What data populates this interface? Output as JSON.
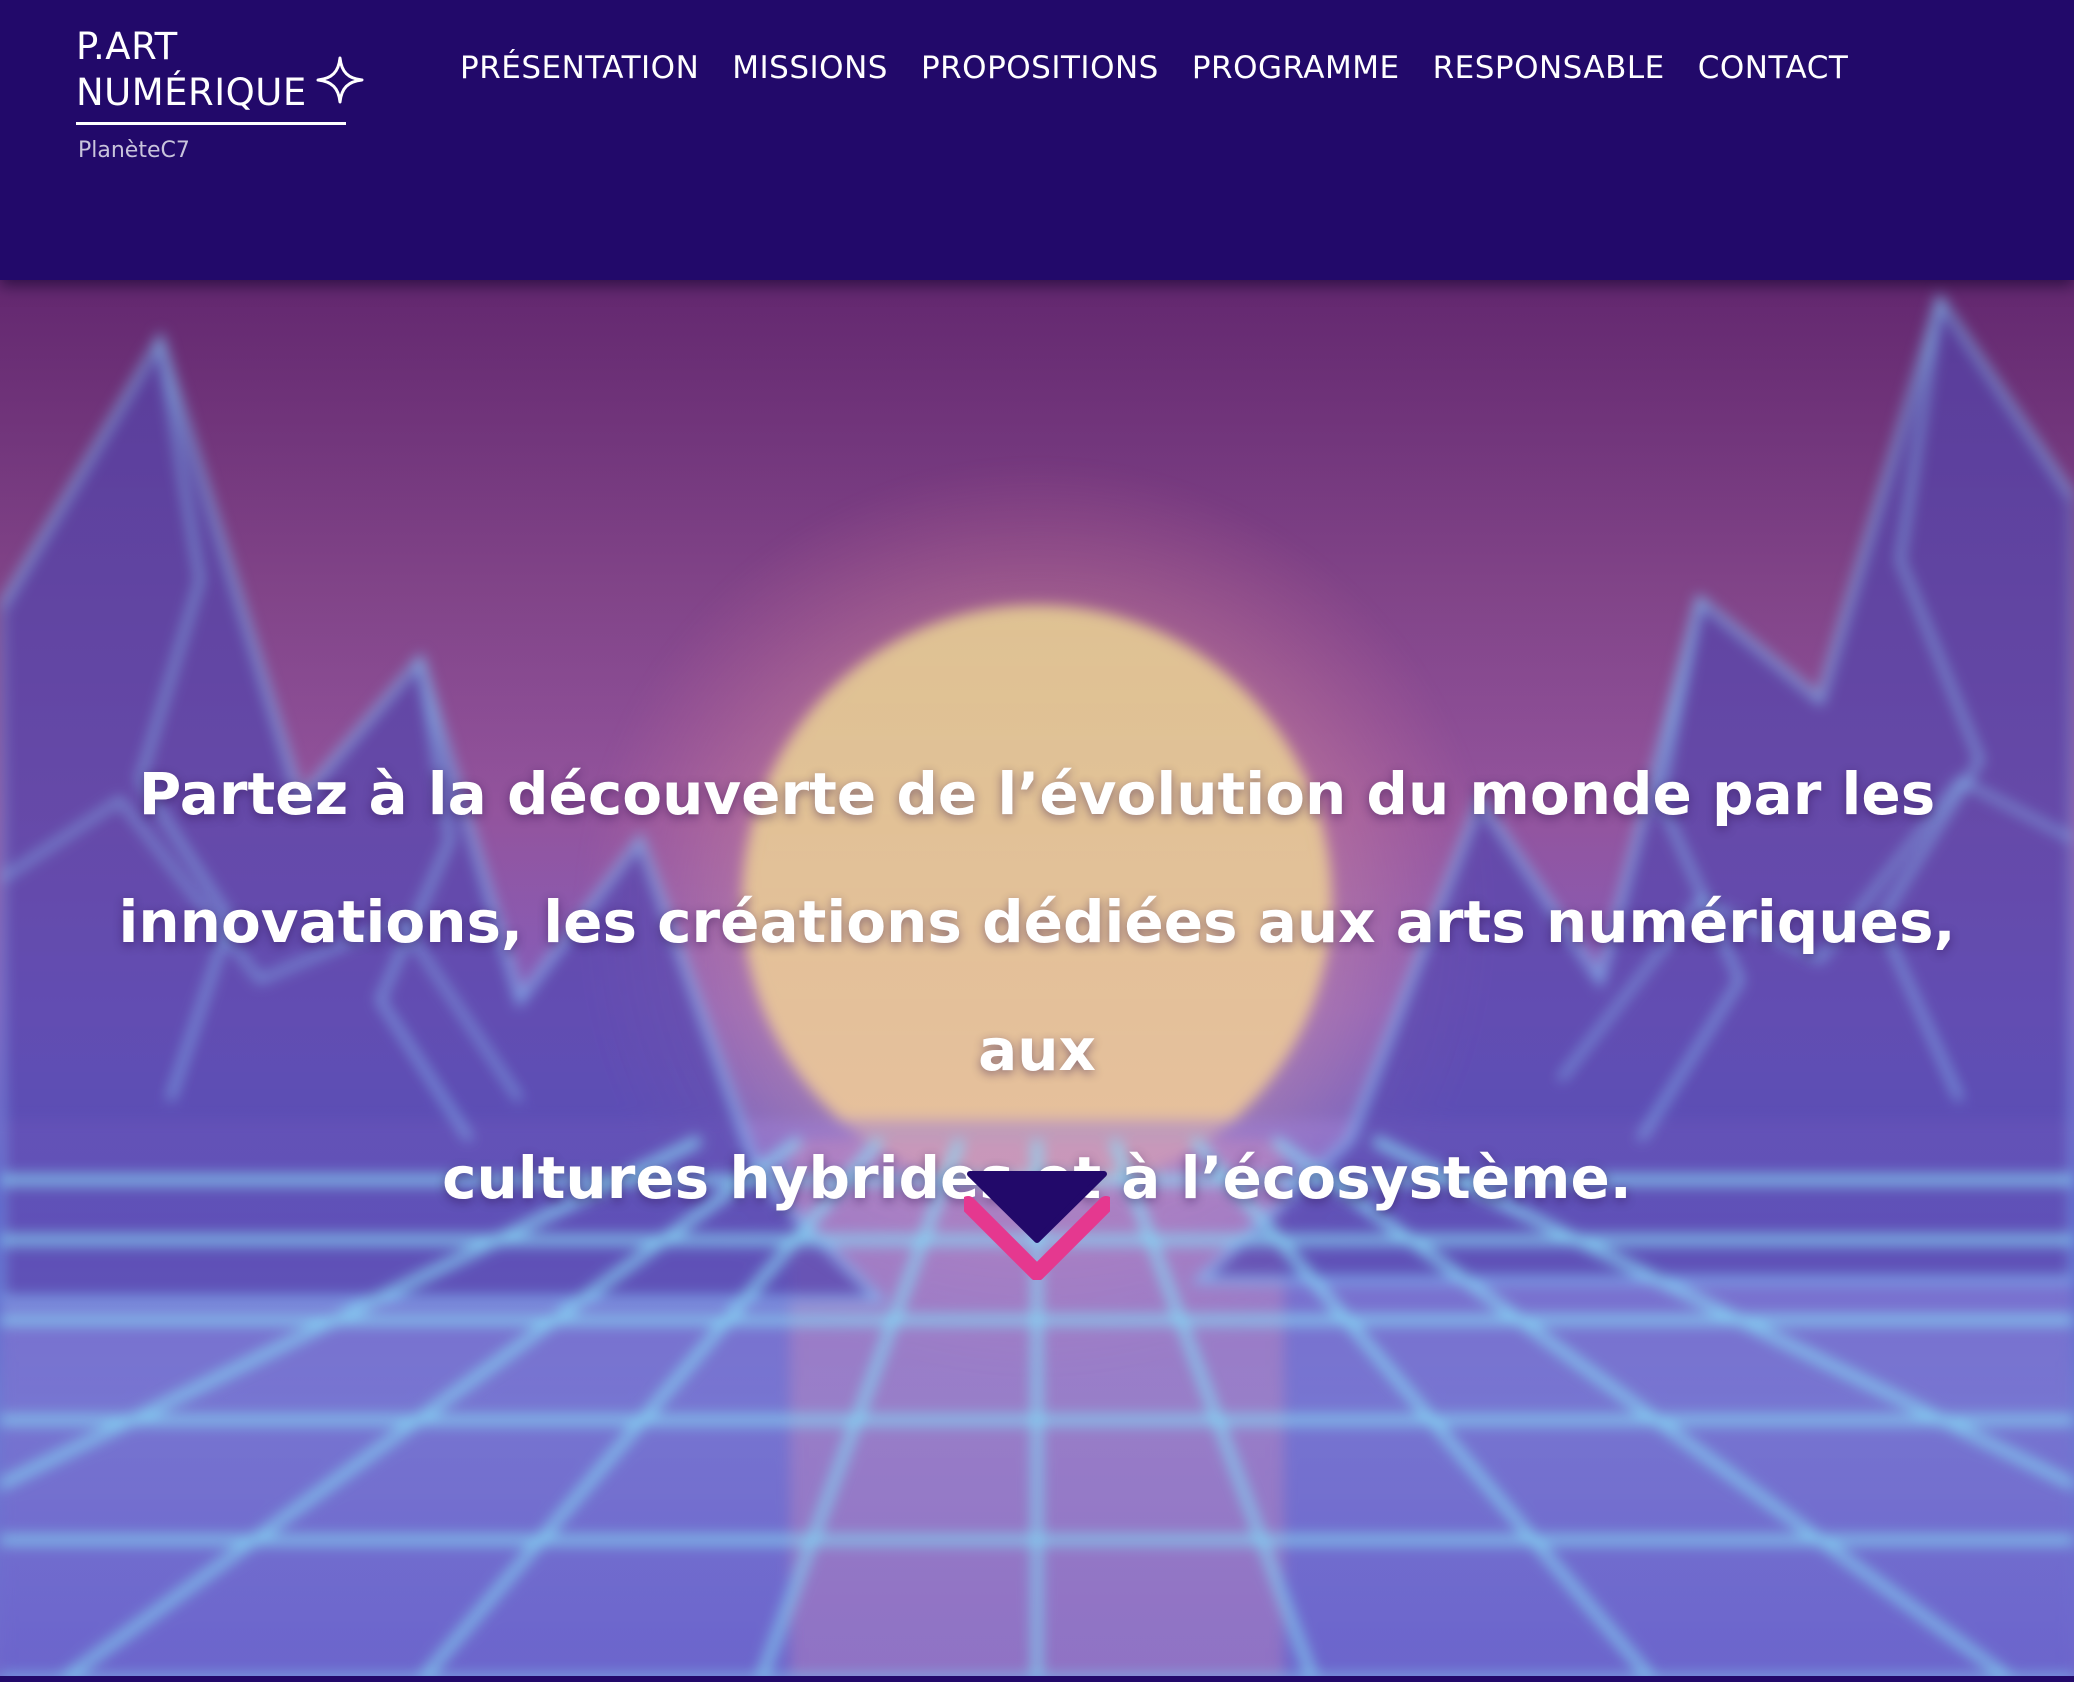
{
  "header": {
    "logo": {
      "line1": "P.ART",
      "line2": "NUMÉRIQUE",
      "subtitle": "PlanèteC7",
      "icon": "four-point-star-icon"
    },
    "nav": [
      {
        "label": "PRÉSENTATION"
      },
      {
        "label": "MISSIONS"
      },
      {
        "label": "PROPOSITIONS"
      },
      {
        "label": "PROGRAMME"
      },
      {
        "label": "RESPONSABLE"
      },
      {
        "label": "CONTACT"
      }
    ]
  },
  "hero": {
    "lines": [
      "Partez à la découverte de l’évolution du monde par les",
      "innovations, les créations dédiées aux arts numériques, aux",
      "cultures hybrides et à l’écosystème."
    ],
    "scroll_icon": "chevron-down-icon"
  },
  "colors": {
    "header_bg": "#22096a",
    "text": "#ffffff",
    "chevron_dark": "#22096a",
    "chevron_pink": "#e5388f"
  }
}
